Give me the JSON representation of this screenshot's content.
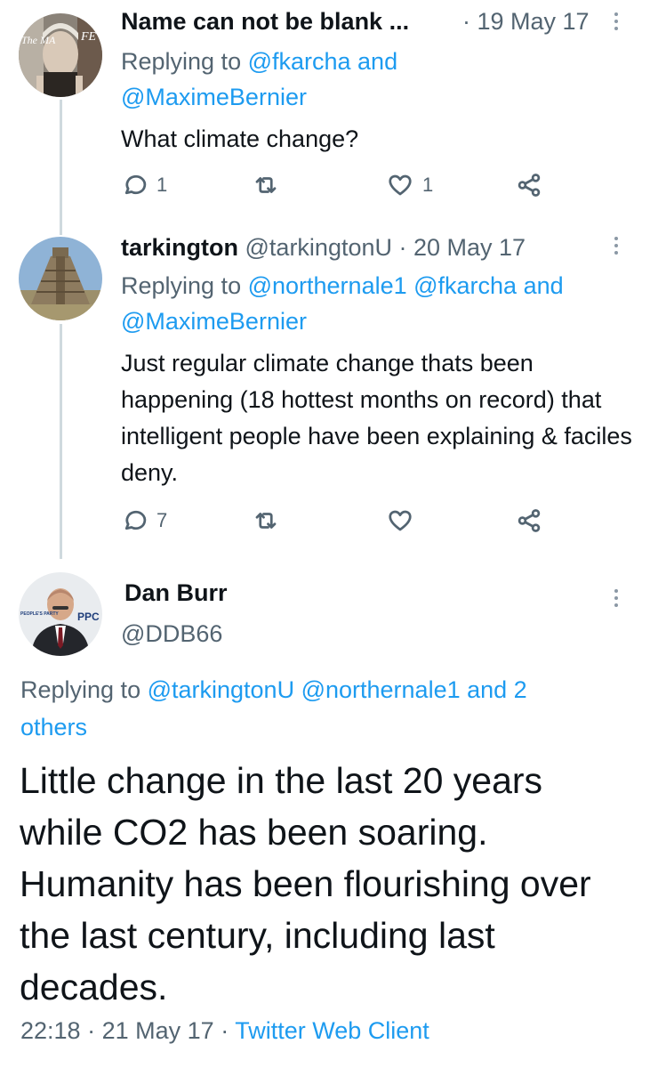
{
  "tweets": [
    {
      "display_name": "Name can not be blank ...",
      "meta": "· 19 May 17",
      "replying_prefix": "Replying to ",
      "mentions_line1": "@fkarcha and",
      "mentions_line2": "@MaximeBernier",
      "text": "What climate change?",
      "reply_count": "1",
      "retweet_count": "",
      "like_count": "1",
      "avatar_text_left": "The MA",
      "avatar_text_right": "FE"
    },
    {
      "display_name": "tarkington",
      "handle_meta": "@tarkingtonU · 20 May 17",
      "replying_prefix": "Replying to ",
      "mentions_line1": "@northernale1 @fkarcha and",
      "mentions_line2": "@MaximeBernier",
      "text": "Just regular climate change thats been happening (18 hottest months on record) that intelligent people have been explaining & faciles deny.",
      "reply_count": "7",
      "retweet_count": "",
      "like_count": ""
    }
  ],
  "main_tweet": {
    "display_name": "Dan Burr",
    "handle": "@DDB66",
    "avatar_text_left": "PEOPLE'S PARTY",
    "avatar_text_right": "PPC",
    "replying_prefix": "Replying to ",
    "mentions": "@tarkingtonU @northernale1",
    "and_text": " and ",
    "others_line1": "2",
    "others_line2": "others",
    "text": "Little change in the last 20 years while CO2 has been soaring. Humanity has been flourishing over the last century, including last decades.",
    "time": "22:18",
    "sep1": "·",
    "date": "21 May 17",
    "sep2": "·",
    "client": "Twitter Web Client"
  },
  "colors": {
    "link": "#1d9bf0",
    "secondary": "#536471",
    "thread_line": "#cfd9de"
  }
}
